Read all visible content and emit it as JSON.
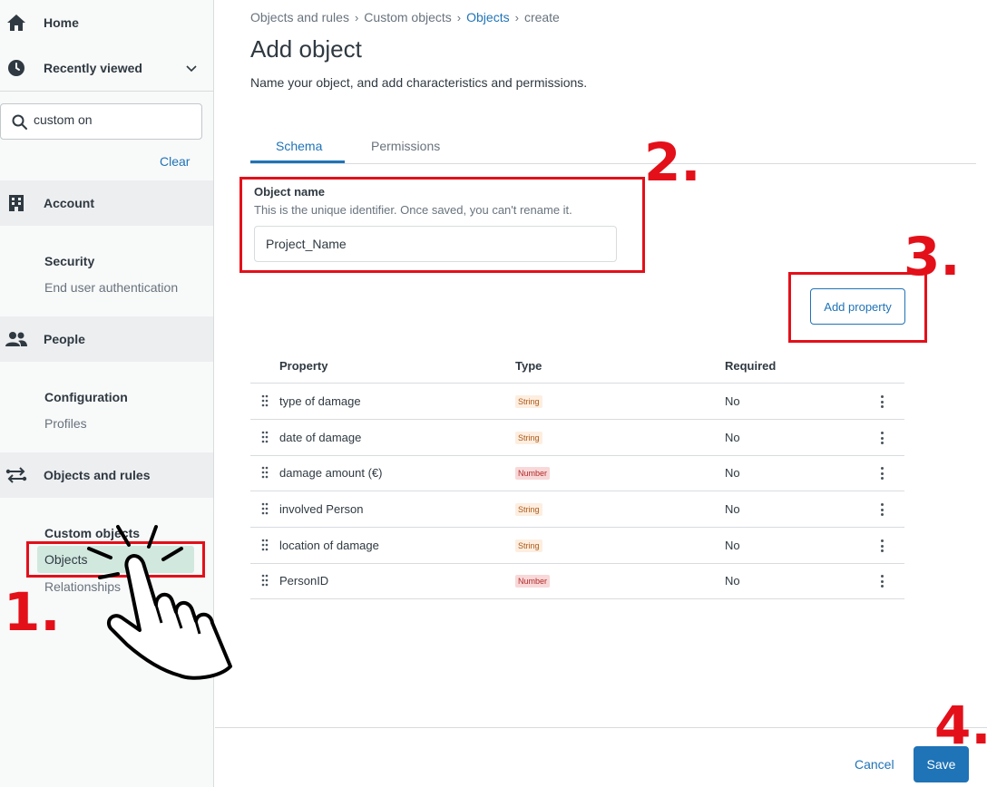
{
  "sidebar": {
    "home": "Home",
    "recently_viewed": "Recently viewed",
    "search": {
      "value": "custom on",
      "placeholder": ""
    },
    "clear": "Clear",
    "account": "Account",
    "security_heading": "Security",
    "end_user_auth": "End user authentication",
    "people": "People",
    "configuration_heading": "Configuration",
    "profiles": "Profiles",
    "objects_and_rules": "Objects and rules",
    "custom_objects_heading": "Custom objects",
    "objects": "Objects",
    "relationships": "Relationships"
  },
  "breadcrumb": [
    "Objects and rules",
    "Custom objects",
    "Objects",
    "create"
  ],
  "page": {
    "title": "Add object",
    "description": "Name your object, and add characteristics and permissions."
  },
  "tabs": [
    {
      "label": "Schema",
      "active": true
    },
    {
      "label": "Permissions",
      "active": false
    }
  ],
  "object_name": {
    "label": "Object name",
    "hint": "This is the unique identifier. Once saved, you can't rename it.",
    "value": "Project_Name"
  },
  "add_property_label": "Add property",
  "table": {
    "headers": [
      "Property",
      "Type",
      "Required"
    ],
    "rows": [
      {
        "property": "type of damage",
        "type": "String",
        "required": "No"
      },
      {
        "property": "date of damage",
        "type": "String",
        "required": "No"
      },
      {
        "property": "damage amount (€)",
        "type": "Number",
        "required": "No"
      },
      {
        "property": "involved Person",
        "type": "String",
        "required": "No"
      },
      {
        "property": "location of damage",
        "type": "String",
        "required": "No"
      },
      {
        "property": "PersonID",
        "type": "Number",
        "required": "No"
      }
    ]
  },
  "footer": {
    "cancel": "Cancel",
    "save": "Save"
  },
  "annotations": {
    "step1": "1.",
    "step2": "2.",
    "step3": "3.",
    "step4": "4."
  },
  "colors": {
    "accent": "#1f73b7",
    "annotation": "#e3101a",
    "active_nav": "#d1e8df"
  }
}
